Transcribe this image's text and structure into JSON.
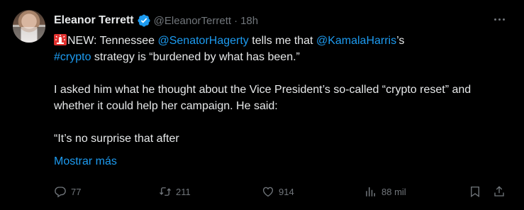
{
  "author": {
    "name": "Eleanor Terrett",
    "handle": "@EleanorTerrett",
    "separator": "·",
    "time": "18h"
  },
  "tweet": {
    "line1": {
      "prefix": "NEW: Tennessee ",
      "mention1": "@SenatorHagerty",
      "middle": " tells me that ",
      "mention2": "@KamalaHarris",
      "suffix": "’s"
    },
    "line2": {
      "hashtag": "#crypto",
      "rest": " strategy is “burdened by what has been.”"
    },
    "para2": "I asked him what he thought about the Vice President’s so-called “crypto reset” and whether it could help her campaign. He said:",
    "para3": "“It’s no surprise that after",
    "show_more": "Mostrar más"
  },
  "actions": {
    "replies": "77",
    "retweets": "211",
    "likes": "914",
    "views": "88 mil"
  },
  "colors": {
    "background": "#000000",
    "text": "#e7e9ea",
    "muted": "#71767b",
    "accent": "#1d9bf0"
  },
  "icons": [
    "verified-badge-icon",
    "more-icon",
    "siren-emoji-icon",
    "reply-icon",
    "retweet-icon",
    "like-icon",
    "views-icon",
    "bookmark-icon",
    "share-icon"
  ]
}
